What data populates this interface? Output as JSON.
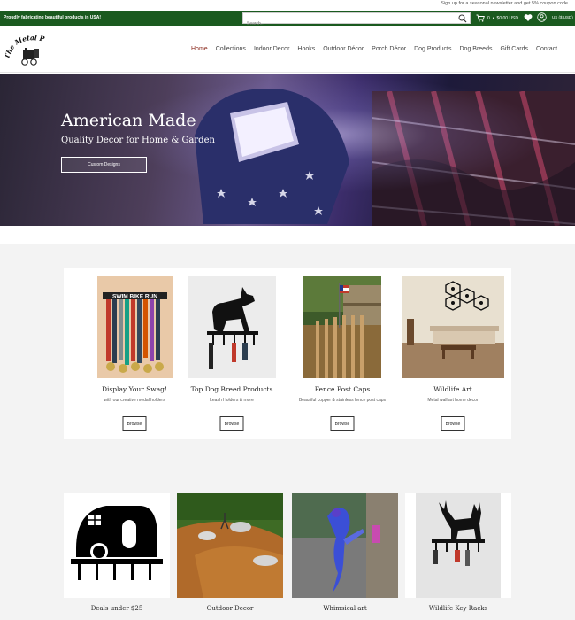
{
  "topbar": {
    "newsletter": "Sign up for a seasonal newsletter and get 5% coupon code"
  },
  "greenbar": {
    "promo": "Proudly fabricating beautiful products in USA!",
    "search_placeholder": "Search...",
    "cart_count": "0",
    "cart_total": "$0.00 USD",
    "currency": "US ($ USD)"
  },
  "brand": {
    "logo_text": "The Metal Peddler"
  },
  "nav": {
    "items": [
      "Home",
      "Collections",
      "Indoor Decor",
      "Hooks",
      "Outdoor Décor",
      "Porch Décor",
      "Dog Products",
      "Dog Breeds",
      "Gift Cards",
      "Contact"
    ],
    "active": "Home"
  },
  "hero": {
    "title": "American Made",
    "subtitle": "Quality Decor for Home & Garden",
    "cta": "Custom Designs"
  },
  "featured": [
    {
      "title": "Display Your Swag!",
      "subtitle": "with our creative medal holders",
      "button": "Browse"
    },
    {
      "title": "Top Dog Breed Products",
      "subtitle": "Leash Holders & more",
      "button": "Browse"
    },
    {
      "title": "Fence Post Caps",
      "subtitle": "Beautiful copper & stainless fence post caps",
      "button": "Browse"
    },
    {
      "title": "Wildlife Art",
      "subtitle": "Metal wall art home decor",
      "button": "Browse"
    }
  ],
  "medal_sign": "SWIM BIKE RUN",
  "collections": [
    {
      "label": "Deals under $25"
    },
    {
      "label": "Outdoor Decor"
    },
    {
      "label": "Whimsical art"
    },
    {
      "label": "Wildlife Key Racks"
    }
  ],
  "colors": {
    "green_bar": "#1a5a1f",
    "active_nav": "#8b2a1e",
    "section_gray": "#f3f3f3"
  }
}
